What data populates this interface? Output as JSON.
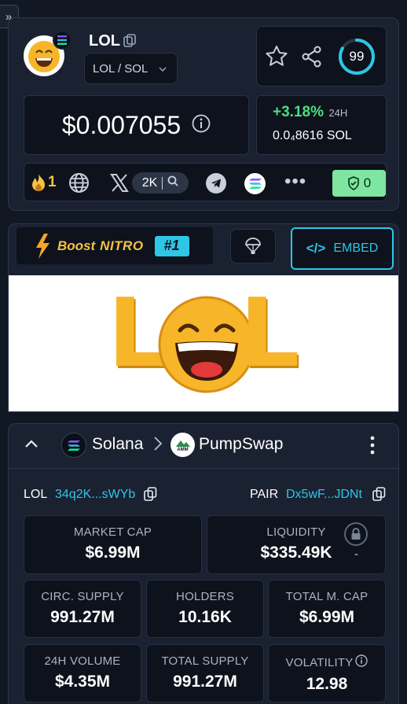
{
  "token": {
    "symbol": "LOL",
    "pair_label": "LOL / SOL",
    "rank_score": "99",
    "price": "$0.007055",
    "change_pct": "+3.18%",
    "change_period": "24H",
    "price_sol": "0.0₄8616 SOL"
  },
  "social": {
    "hot_count": "1",
    "x_followers": "2K",
    "shield_count": "0"
  },
  "promo": {
    "boost_label": "Boost",
    "nitro_label": "NITRO",
    "rank_label": "#1",
    "embed_label": "EMBED"
  },
  "banner": {
    "letters": [
      "L",
      "L"
    ]
  },
  "chain": {
    "network": "Solana",
    "dex": "PumpSwap",
    "dex_badge": "AMM"
  },
  "addresses": {
    "token_label": "LOL",
    "token_addr": "34q2K...sWYb",
    "pair_label": "PAIR",
    "pair_addr": "Dx5wF...JDNt"
  },
  "stats": {
    "market_cap": {
      "label": "MARKET CAP",
      "value": "$6.99M"
    },
    "liquidity": {
      "label": "LIQUIDITY",
      "value": "$335.49K",
      "extra": "-"
    },
    "circ_supply": {
      "label": "CIRC. SUPPLY",
      "value": "991.27M"
    },
    "holders": {
      "label": "HOLDERS",
      "value": "10.16K"
    },
    "total_mcap": {
      "label": "TOTAL M. CAP",
      "value": "$6.99M"
    },
    "volume_24h": {
      "label": "24H VOLUME",
      "value": "$4.35M"
    },
    "total_supply": {
      "label": "TOTAL SUPPLY",
      "value": "991.27M"
    },
    "volatility": {
      "label": "VOLATILITY",
      "value": "12.98"
    }
  },
  "colors": {
    "accent": "#2ec6e6",
    "positive": "#4ade80",
    "shield_bg": "#7ee6a1"
  }
}
